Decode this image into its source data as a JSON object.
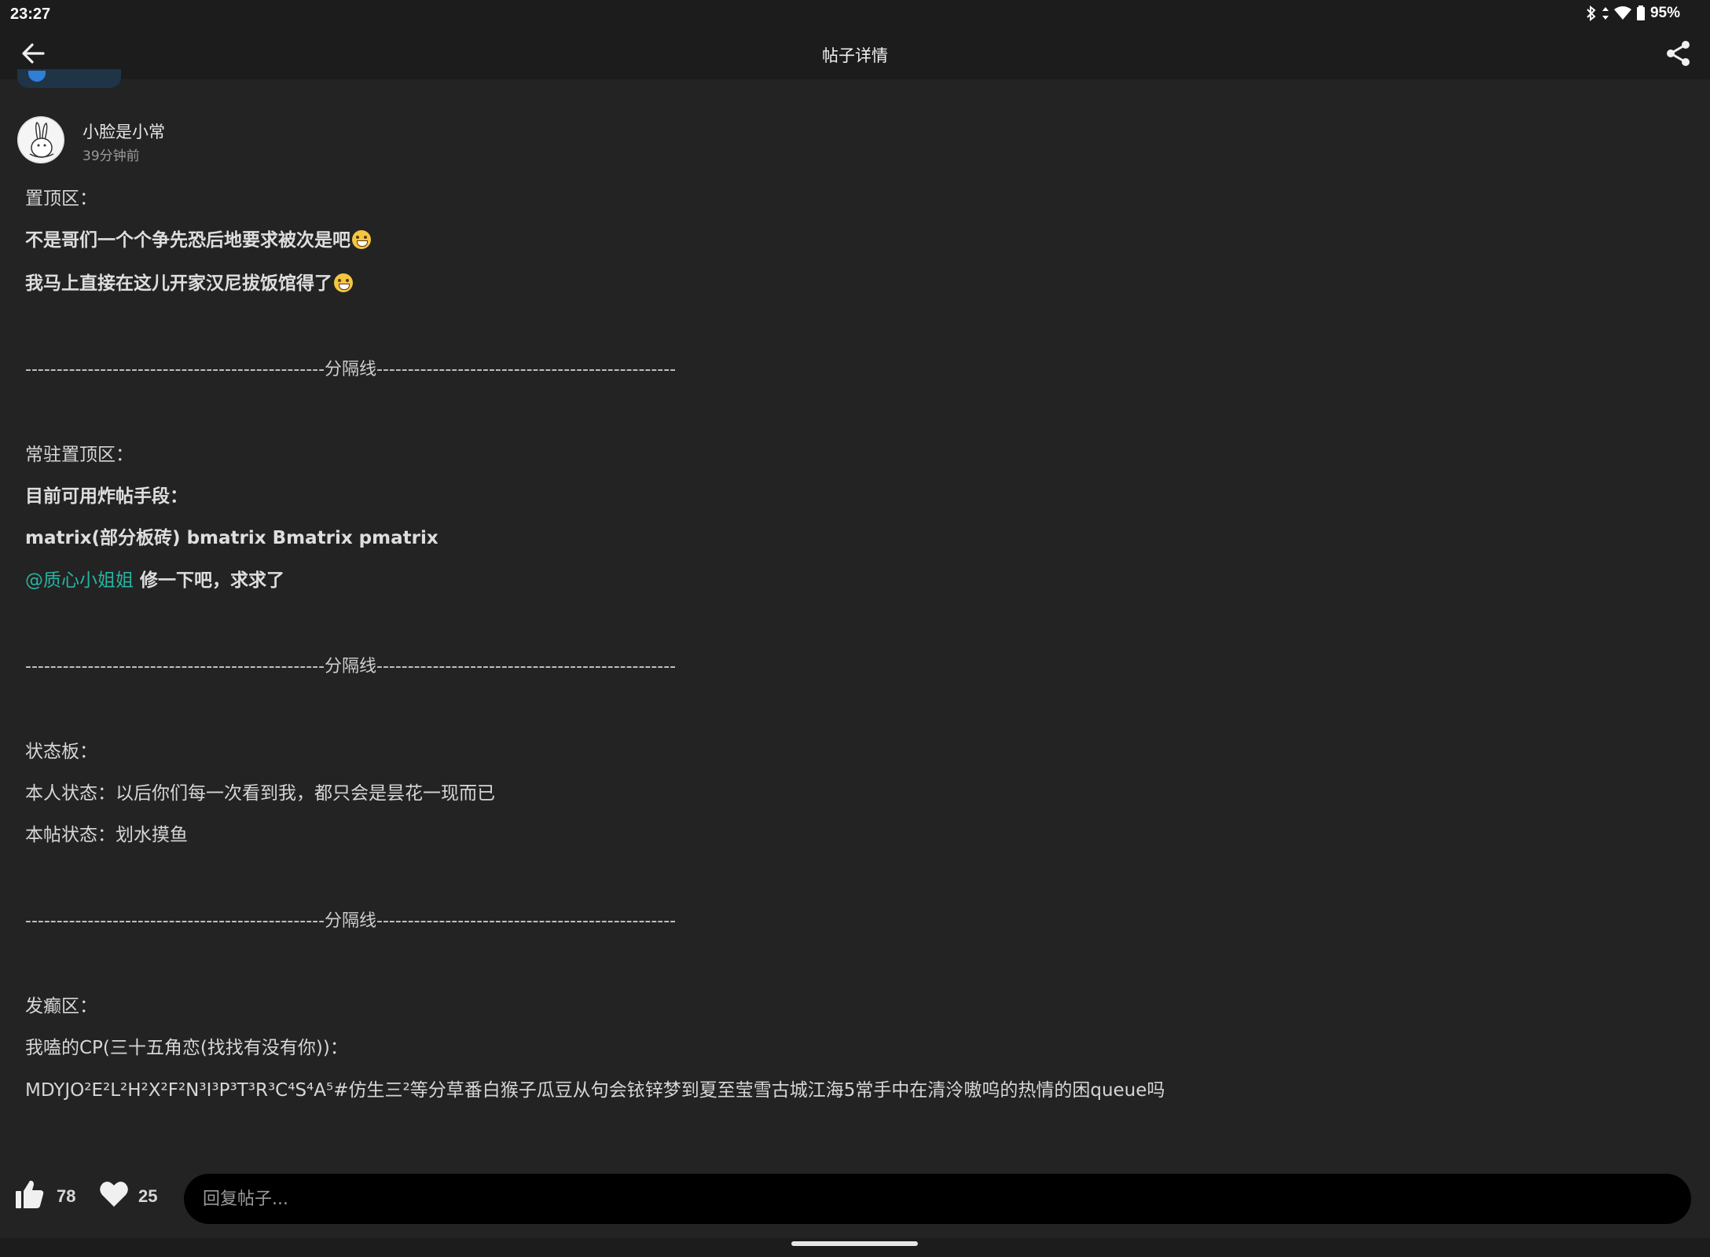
{
  "status_bar": {
    "time": "23:27",
    "battery": "95%"
  },
  "app_bar": {
    "title": "帖子详情"
  },
  "post": {
    "author_name": "小脸是小常",
    "time_ago": "39分钟前",
    "lines": {
      "l1": "置顶区：",
      "l2": "不是哥们一个个争先恐后地要求被次是吧",
      "l3": "我马上直接在这儿开家汉尼拔饭馆得了",
      "div1": "------------------------------------------------分隔线------------------------------------------------",
      "l4": "常驻置顶区：",
      "l5": "目前可用炸帖手段：",
      "l6": "matrix(部分板砖) bmatrix Bmatrix pmatrix",
      "mention": "@质心小姐姐",
      "l7_rest": " 修一下吧，求求了",
      "div2": "------------------------------------------------分隔线------------------------------------------------",
      "l8": "状态板：",
      "l9": "本人状态：以后你们每一次看到我，都只会是昙花一现而已",
      "l10": "本帖状态：划水摸鱼",
      "div3": "------------------------------------------------分隔线------------------------------------------------",
      "l11": "发癫区：",
      "l12": "我嗑的CP(三十五角恋(找找有没有你))：",
      "l13": "MDYJO²E²L²H²X²F²N³I³P³T³R³C⁴S⁴A⁵#仿生三²等分草番白猴子瓜豆从句会铱锌梦到夏至莹雪古城江海5常手中在清泠嗷呜的热情的困queue吗"
    }
  },
  "bottom_bar": {
    "like_count": "78",
    "fav_count": "25",
    "reply_placeholder": "回复帖子..."
  },
  "icons": {
    "back": "arrow-left-icon",
    "share": "share-icon",
    "like": "thumbs-up-icon",
    "favorite": "heart-icon",
    "emoji": "grinning-sweat-emoji-icon"
  },
  "colors": {
    "background": "#232323",
    "bar": "#1c1c1c",
    "mention": "#27b3a3",
    "input_bg": "#000000"
  }
}
